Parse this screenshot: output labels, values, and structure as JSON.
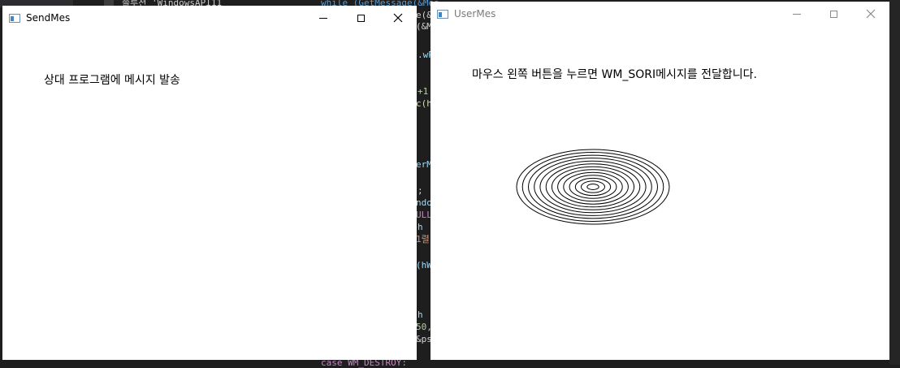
{
  "background": {
    "code_left": "솔루션 'WindowsAPI11",
    "code_main": "while (GetMessage(&Mes",
    "snippets": [
      "e(&",
      "(&M",
      ".wP",
      "+1",
      "c(h",
      "erM",
      ";",
      "ndo",
      "ULL",
      "h",
      "1렬",
      "(hW",
      "h",
      "50,",
      "&ps",
      "case WM_DESTROY:"
    ]
  },
  "send_window": {
    "title": "SendMes",
    "message": "상대 프로그램에 메시지 발송",
    "colors": {
      "title_text": "#000000",
      "controls": "#000000"
    }
  },
  "user_window": {
    "title": "UserMes",
    "message": "마우스 왼쪽 버튼을 누르면 WM_SORI메시지를 전달합니다.",
    "colors": {
      "title_text": "#7a7a7a",
      "controls": "#8a8a8a"
    },
    "ellipse_count": 13
  }
}
